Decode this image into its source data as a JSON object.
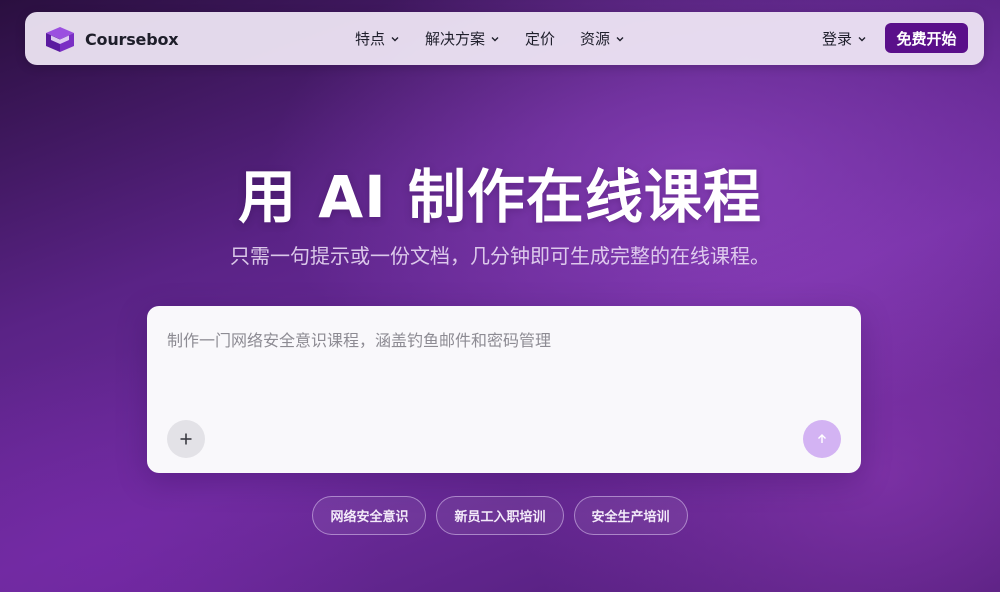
{
  "brand": {
    "name": "Coursebox",
    "logo_icon": "graduation-cap-cube-icon"
  },
  "nav": {
    "items": [
      {
        "label": "特点",
        "icon": "chevron-down-icon"
      },
      {
        "label": "解决方案",
        "icon": "chevron-down-icon"
      },
      {
        "label": "定价"
      },
      {
        "label": "资源",
        "icon": "chevron-down-icon"
      }
    ],
    "login_label": "登录",
    "cta_label": "免费开始"
  },
  "hero": {
    "title": "用 AI 制作在线课程",
    "subtitle": "只需一句提示或一份文档，几分钟即可生成完整的在线课程。"
  },
  "prompt": {
    "placeholder": "制作一门网络安全意识课程，涵盖钓鱼邮件和密码管理",
    "add_icon": "plus-icon",
    "send_icon": "arrow-up-icon"
  },
  "suggestions": [
    "网络安全意识",
    "新员工入职培训",
    "安全生产培训"
  ],
  "colors": {
    "accent": "#5a0f8a",
    "send_button": "#d3b3f3",
    "background": "#6e2c9e"
  }
}
